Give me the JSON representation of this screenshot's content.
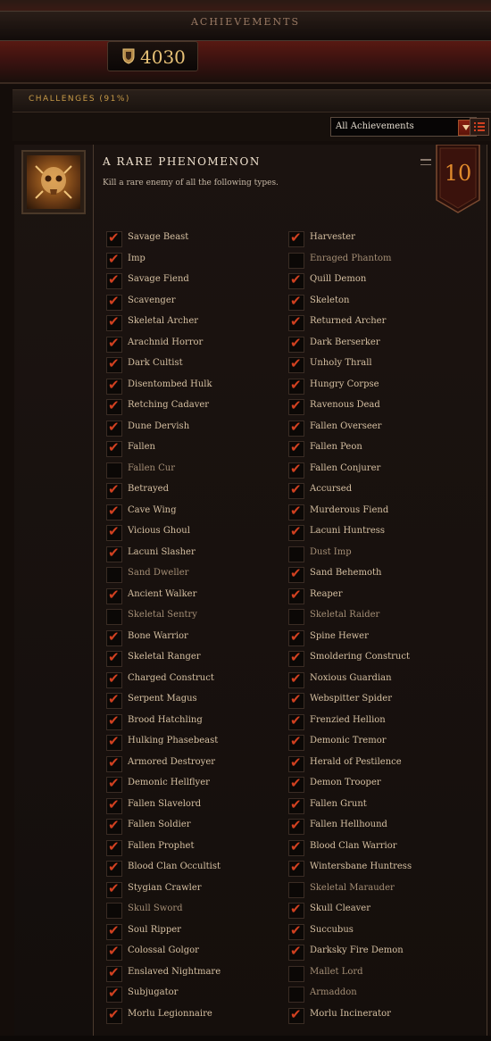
{
  "header": {
    "title": "ACHIEVEMENTS",
    "points": "4030"
  },
  "challenges_bar": {
    "label": "CHALLENGES (91%)"
  },
  "filter": {
    "selected": "All Achievements"
  },
  "achievement": {
    "title": "A RARE PHENOMENON",
    "description": "Kill a rare enemy of all the following types.",
    "points": "10",
    "criteria_left": [
      {
        "name": "Savage Beast",
        "done": true
      },
      {
        "name": "Imp",
        "done": true
      },
      {
        "name": "Savage Fiend",
        "done": true
      },
      {
        "name": "Scavenger",
        "done": true
      },
      {
        "name": "Skeletal Archer",
        "done": true
      },
      {
        "name": "Arachnid Horror",
        "done": true
      },
      {
        "name": "Dark Cultist",
        "done": true
      },
      {
        "name": "Disentombed Hulk",
        "done": true
      },
      {
        "name": "Retching Cadaver",
        "done": true
      },
      {
        "name": "Dune Dervish",
        "done": true
      },
      {
        "name": "Fallen",
        "done": true
      },
      {
        "name": "Fallen Cur",
        "done": false
      },
      {
        "name": "Betrayed",
        "done": true
      },
      {
        "name": "Cave Wing",
        "done": true
      },
      {
        "name": "Vicious Ghoul",
        "done": true
      },
      {
        "name": "Lacuni Slasher",
        "done": true
      },
      {
        "name": "Sand Dweller",
        "done": false
      },
      {
        "name": "Ancient Walker",
        "done": true
      },
      {
        "name": "Skeletal Sentry",
        "done": false
      },
      {
        "name": "Bone Warrior",
        "done": true
      },
      {
        "name": "Skeletal Ranger",
        "done": true
      },
      {
        "name": "Charged Construct",
        "done": true
      },
      {
        "name": "Serpent Magus",
        "done": true
      },
      {
        "name": "Brood Hatchling",
        "done": true
      },
      {
        "name": "Hulking Phasebeast",
        "done": true
      },
      {
        "name": "Armored Destroyer",
        "done": true
      },
      {
        "name": "Demonic Hellflyer",
        "done": true
      },
      {
        "name": "Fallen Slavelord",
        "done": true
      },
      {
        "name": "Fallen Soldier",
        "done": true
      },
      {
        "name": "Fallen Prophet",
        "done": true
      },
      {
        "name": "Blood Clan Occultist",
        "done": true
      },
      {
        "name": "Stygian Crawler",
        "done": true
      },
      {
        "name": "Skull Sword",
        "done": false
      },
      {
        "name": "Soul Ripper",
        "done": true
      },
      {
        "name": "Colossal Golgor",
        "done": true
      },
      {
        "name": "Enslaved Nightmare",
        "done": true
      },
      {
        "name": "Subjugator",
        "done": true
      },
      {
        "name": "Morlu Legionnaire",
        "done": true
      }
    ],
    "criteria_right": [
      {
        "name": "Harvester",
        "done": true
      },
      {
        "name": "Enraged Phantom",
        "done": false
      },
      {
        "name": "Quill Demon",
        "done": true
      },
      {
        "name": "Skeleton",
        "done": true
      },
      {
        "name": "Returned Archer",
        "done": true
      },
      {
        "name": "Dark Berserker",
        "done": true
      },
      {
        "name": "Unholy Thrall",
        "done": true
      },
      {
        "name": "Hungry Corpse",
        "done": true
      },
      {
        "name": "Ravenous Dead",
        "done": true
      },
      {
        "name": "Fallen Overseer",
        "done": true
      },
      {
        "name": "Fallen Peon",
        "done": true
      },
      {
        "name": "Fallen Conjurer",
        "done": true
      },
      {
        "name": "Accursed",
        "done": true
      },
      {
        "name": "Murderous Fiend",
        "done": true
      },
      {
        "name": "Lacuni Huntress",
        "done": true
      },
      {
        "name": "Dust Imp",
        "done": false
      },
      {
        "name": "Sand Behemoth",
        "done": true
      },
      {
        "name": "Reaper",
        "done": true
      },
      {
        "name": "Skeletal Raider",
        "done": false
      },
      {
        "name": "Spine Hewer",
        "done": true
      },
      {
        "name": "Smoldering Construct",
        "done": true
      },
      {
        "name": "Noxious Guardian",
        "done": true
      },
      {
        "name": "Webspitter Spider",
        "done": true
      },
      {
        "name": "Frenzied Hellion",
        "done": true
      },
      {
        "name": "Demonic Tremor",
        "done": true
      },
      {
        "name": "Herald of Pestilence",
        "done": true
      },
      {
        "name": "Demon Trooper",
        "done": true
      },
      {
        "name": "Fallen Grunt",
        "done": true
      },
      {
        "name": "Fallen Hellhound",
        "done": true
      },
      {
        "name": "Blood Clan Warrior",
        "done": true
      },
      {
        "name": "Wintersbane Huntress",
        "done": true
      },
      {
        "name": "Skeletal Marauder",
        "done": false
      },
      {
        "name": "Skull Cleaver",
        "done": true
      },
      {
        "name": "Succubus",
        "done": true
      },
      {
        "name": "Darksky Fire Demon",
        "done": true
      },
      {
        "name": "Mallet Lord",
        "done": false
      },
      {
        "name": "Armaddon",
        "done": false
      },
      {
        "name": "Morlu Incinerator",
        "done": true
      }
    ]
  }
}
